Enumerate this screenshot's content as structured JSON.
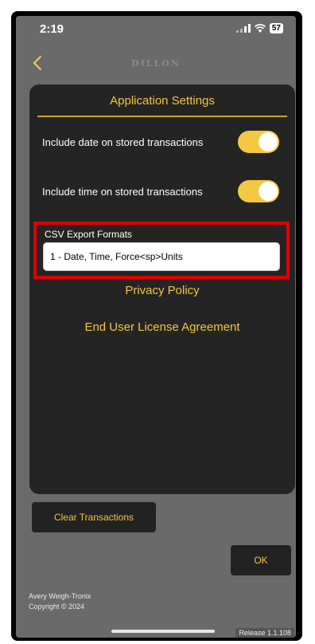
{
  "status_bar": {
    "time": "2:19",
    "battery": "57"
  },
  "nav": {
    "logo_text": "DILLON",
    "back_icon": "chevron-left-icon"
  },
  "settings_card": {
    "title": "Application Settings",
    "include_date": {
      "label": "Include date on stored transactions",
      "enabled": true
    },
    "include_time": {
      "label": "Include time on stored transactions",
      "enabled": true
    },
    "csv_export": {
      "label": "CSV Export Formats",
      "value": "1 - Date, Time, Force<sp>Units"
    },
    "privacy_policy_label": "Privacy Policy",
    "eula_label": "End User License Agreement"
  },
  "buttons": {
    "clear_transactions": "Clear Transactions",
    "ok": "OK"
  },
  "footer": {
    "company": "Avery Weigh-Tronix",
    "copyright": "Copyright © 2024",
    "release": "Release 1.1.108"
  },
  "colors": {
    "accent": "#f4c442",
    "card": "#242424",
    "background": "#6a6a6a",
    "highlight": "#e00000"
  }
}
